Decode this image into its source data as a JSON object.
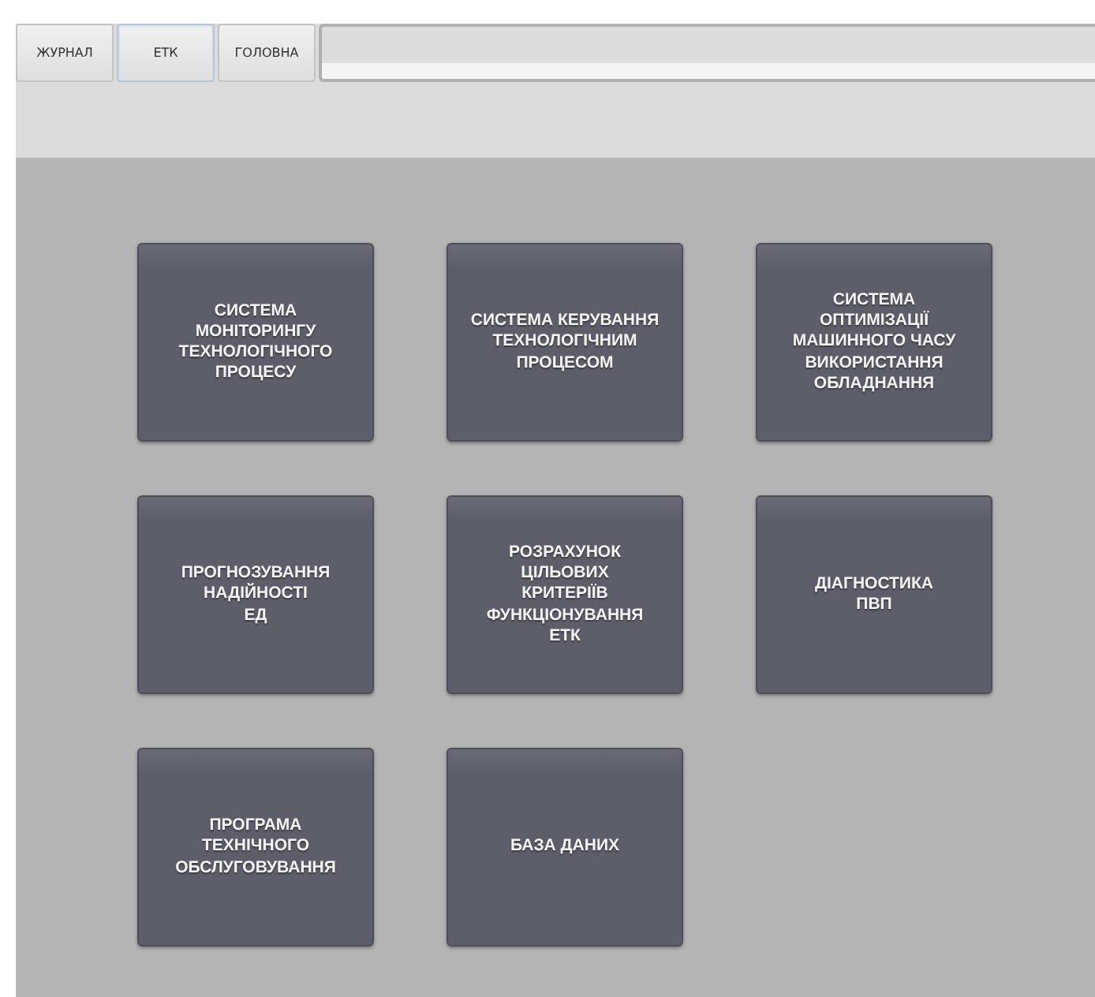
{
  "tabs": [
    {
      "label": "ЖУРНАЛ",
      "selected": false
    },
    {
      "label": "ЕТК",
      "selected": true
    },
    {
      "label": "ГОЛОВНА",
      "selected": false
    }
  ],
  "tiles": [
    {
      "label": "СИСТЕМА\nМОНІТОРИНГУ\nТЕХНОЛОГІЧНОГО\nПРОЦЕСУ"
    },
    {
      "label": "СИСТЕМА КЕРУВАННЯ\nТЕХНОЛОГІЧНИМ\nПРОЦЕСОМ"
    },
    {
      "label": "СИСТЕМА\nОПТИМІЗАЦІЇ\nМАШИННОГО ЧАСУ\nВИКОРИСТАННЯ\nОБЛАДНАННЯ"
    },
    {
      "label": "ПРОГНОЗУВАННЯ\nНАДІЙНОСТІ\nЕД"
    },
    {
      "label": "РОЗРАХУНОК\nЦІЛЬОВИХ\nКРИТЕРІЇВ\nФУНКЦІОНУВАННЯ\nЕТК"
    },
    {
      "label": "ДІАГНОСТИКА\nПВП"
    },
    {
      "label": "ПРОГРАМА\nТЕХНІЧНОГО\nОБСЛУГОВУВАННЯ"
    },
    {
      "label": "БАЗА ДАНИХ"
    }
  ]
}
